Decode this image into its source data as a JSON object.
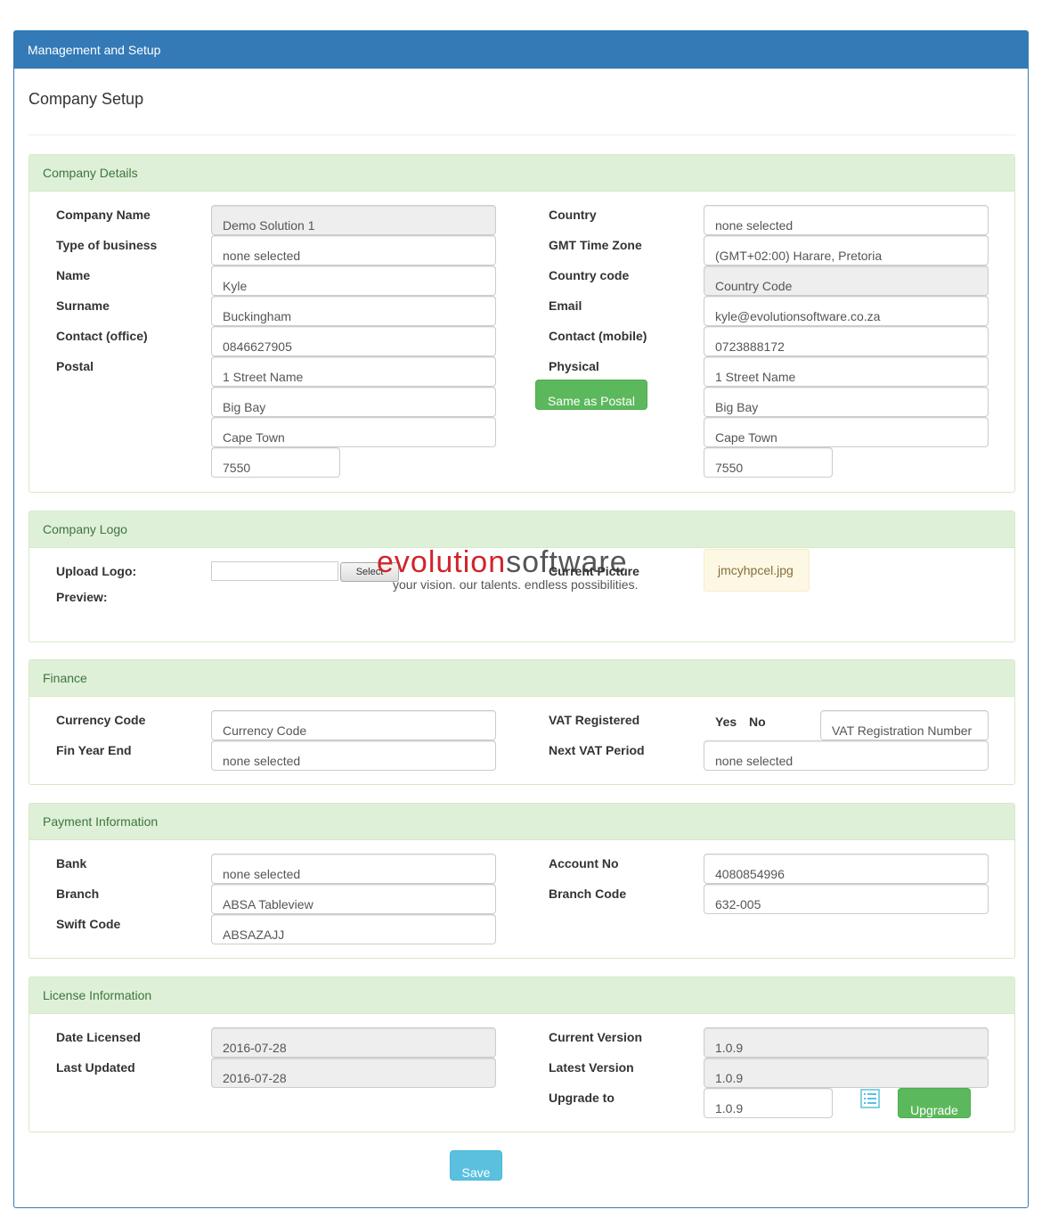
{
  "header": {
    "title": "Management and Setup"
  },
  "page": {
    "title": "Company Setup"
  },
  "colors": {
    "primary": "#337ab7",
    "success": "#5cb85c",
    "info": "#5bc0de",
    "section_bg": "#dff0d8"
  },
  "company_details": {
    "heading": "Company Details",
    "company_name_label": "Company Name",
    "company_name": "Demo Solution 1",
    "business_type_label": "Type of business",
    "business_type": "none selected",
    "name_label": "Name",
    "name": "Kyle",
    "surname_label": "Surname",
    "surname": "Buckingham",
    "contact_office_label": "Contact (office)",
    "contact_office": "0846627905",
    "postal_label": "Postal",
    "postal_line1": "1 Street Name",
    "postal_line2": "Big Bay",
    "postal_line3": "Cape Town",
    "postal_code": "7550",
    "country_label": "Country",
    "country": "none selected",
    "timezone_label": "GMT Time Zone",
    "timezone": "(GMT+02:00) Harare, Pretoria",
    "country_code_label": "Country code",
    "country_code": "Country Code",
    "email_label": "Email",
    "email": "kyle@evolutionsoftware.co.za",
    "contact_mobile_label": "Contact (mobile)",
    "contact_mobile": "0723888172",
    "physical_label": "Physical",
    "same_as_postal": "Same as Postal",
    "physical_line1": "1 Street Name",
    "physical_line2": "Big Bay",
    "physical_line3": "Cape Town",
    "physical_code": "7550"
  },
  "company_logo": {
    "heading": "Company Logo",
    "upload_label": "Upload Logo:",
    "select_label": "Select",
    "preview_label": "Preview:",
    "current_picture_label": "Current Picture",
    "current_picture": "jmcyhpcel.jpg",
    "logo_word1": "evolution",
    "logo_word2": "software",
    "logo_tagline": "your vision.  our talents.  endless possibilities."
  },
  "finance": {
    "heading": "Finance",
    "currency_label": "Currency Code",
    "currency": "Currency Code",
    "fin_year_label": "Fin Year End",
    "fin_year": "none selected",
    "vat_registered_label": "VAT Registered",
    "yes_label": "Yes",
    "no_label": "No",
    "vat_number_placeholder": "VAT Registration Number",
    "next_vat_label": "Next VAT Period",
    "next_vat": "none selected"
  },
  "payment": {
    "heading": "Payment Information",
    "bank_label": "Bank",
    "bank": "none selected",
    "branch_label": "Branch",
    "branch": "ABSA Tableview",
    "swift_label": "Swift Code",
    "swift": "ABSAZAJJ",
    "account_label": "Account No",
    "account": "4080854996",
    "branch_code_label": "Branch Code",
    "branch_code": "632-005"
  },
  "license": {
    "heading": "License Information",
    "date_licensed_label": "Date Licensed",
    "date_licensed": "2016-07-28",
    "last_updated_label": "Last Updated",
    "last_updated": "2016-07-28",
    "current_version_label": "Current Version",
    "current_version": "1.0.9",
    "latest_version_label": "Latest Version",
    "latest_version": "1.0.9",
    "upgrade_to_label": "Upgrade to",
    "upgrade_to": "1.0.9",
    "upgrade_button": "Upgrade"
  },
  "save_button": "Save"
}
